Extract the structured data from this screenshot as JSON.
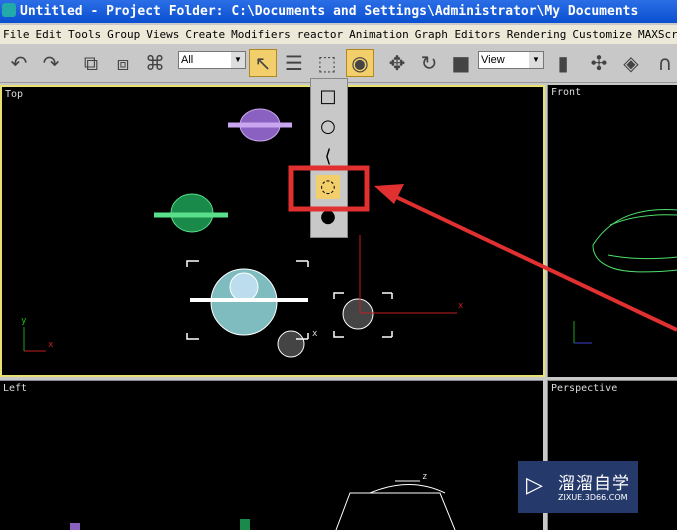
{
  "window": {
    "title": "Untitled      - Project Folder: C:\\Documents and Settings\\Administrator\\My Documents"
  },
  "menu": [
    "File",
    "Edit",
    "Tools",
    "Group",
    "Views",
    "Create",
    "Modifiers",
    "reactor",
    "Animation",
    "Graph Editors",
    "Rendering",
    "Customize",
    "MAXScript"
  ],
  "toolbar": {
    "selection_filter": "All",
    "ref_coord": "View"
  },
  "viewports": {
    "top": "Top",
    "front": "Front",
    "left": "Left",
    "perspective": "Perspective"
  },
  "axes": {
    "x": "x",
    "y": "y",
    "z": "z"
  },
  "colors": {
    "active_border": "#e8e070",
    "highlight": "#e03030",
    "flyout_active": "#f3cf6b"
  },
  "watermark": {
    "name": "溜溜自学",
    "url": "ZIXUE.3D66.COM"
  }
}
